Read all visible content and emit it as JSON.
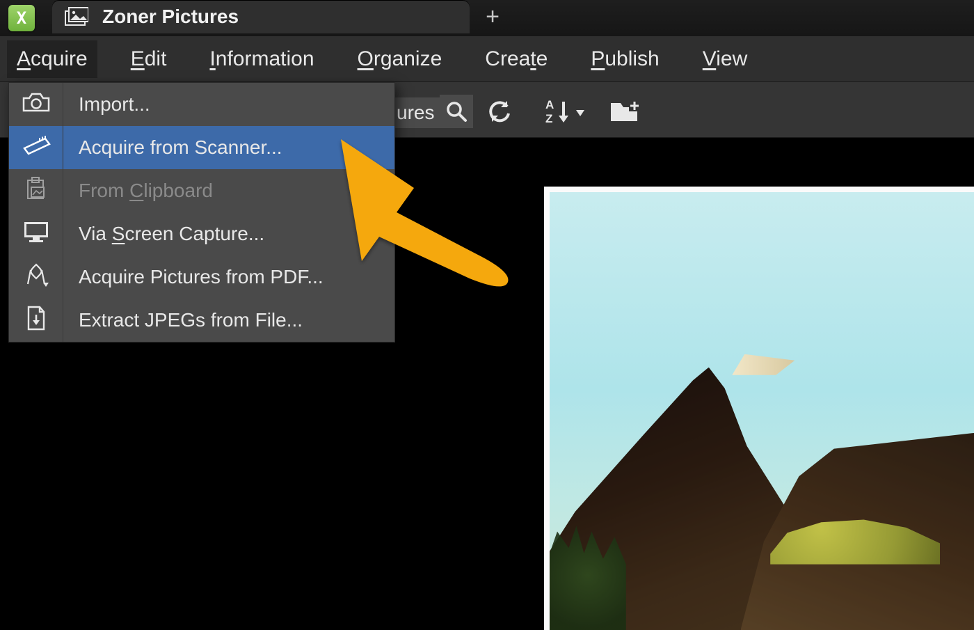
{
  "titlebar": {
    "app_short_label": "X",
    "tab_title": "Zoner Pictures"
  },
  "menubar": {
    "items": [
      {
        "pre": "",
        "ul": "A",
        "post": "cquire",
        "active": true
      },
      {
        "pre": "",
        "ul": "E",
        "post": "dit"
      },
      {
        "pre": "",
        "ul": "I",
        "post": "nformation"
      },
      {
        "pre": "",
        "ul": "O",
        "post": "rganize"
      },
      {
        "pre": "Crea",
        "ul": "t",
        "post": "e"
      },
      {
        "pre": "",
        "ul": "P",
        "post": "ublish"
      },
      {
        "pre": "",
        "ul": "V",
        "post": "iew"
      }
    ]
  },
  "toolbar": {
    "path_fragment": "ures",
    "icons": {
      "search": "search-icon",
      "refresh": "refresh-icon",
      "sort": "sort-az-icon",
      "new_folder": "new-folder-icon"
    }
  },
  "dropdown": {
    "items": [
      {
        "icon": "camera-icon",
        "label_pre": "Import...",
        "label_ul": "",
        "label_post": "",
        "state": "normal"
      },
      {
        "icon": "scanner-icon",
        "label_pre": "Acquire from Scanner...",
        "label_ul": "",
        "label_post": "",
        "state": "highlight"
      },
      {
        "icon": "clipboard-icon",
        "label_pre": "From ",
        "label_ul": "C",
        "label_post": "lipboard",
        "state": "disabled"
      },
      {
        "icon": "monitor-icon",
        "label_pre": "Via ",
        "label_ul": "S",
        "label_post": "creen Capture...",
        "state": "normal"
      },
      {
        "icon": "pdf-icon",
        "label_pre": "Acquire Pictures from PDF...",
        "label_ul": "",
        "label_post": "",
        "state": "normal"
      },
      {
        "icon": "extract-icon",
        "label_pre": "Extract JPEGs from File...",
        "label_ul": "",
        "label_post": "",
        "state": "normal"
      }
    ]
  },
  "colors": {
    "highlight": "#3d6aa9",
    "arrow": "#f5a80b"
  }
}
